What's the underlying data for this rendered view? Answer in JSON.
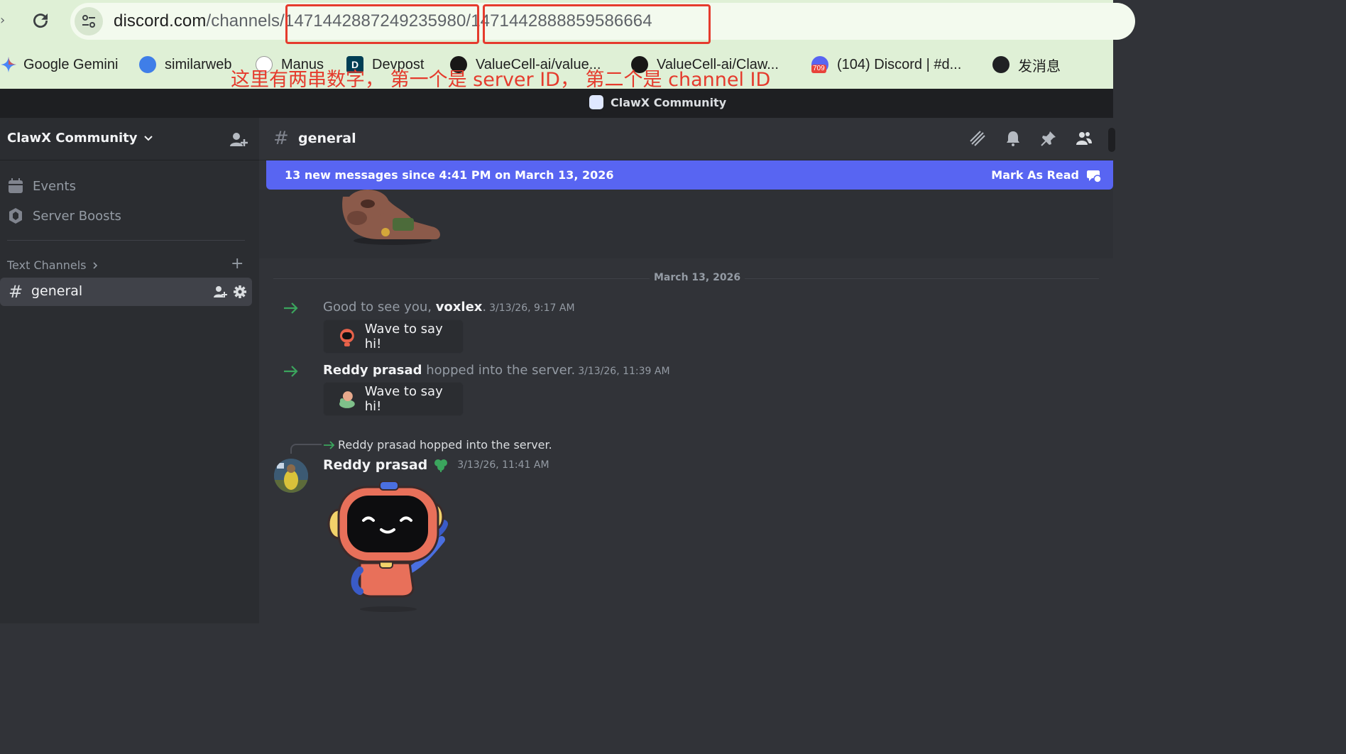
{
  "browser": {
    "url_host": "discord.com",
    "url_path": "/channels/",
    "server_id": "1471442887249235980",
    "url_sep": "/",
    "channel_id": "1471442888859586664",
    "bookmarks": [
      {
        "label": "Google Gemini",
        "icon": "gemini-icon"
      },
      {
        "label": "similarweb",
        "icon": "similarweb-icon"
      },
      {
        "label": "Manus",
        "icon": "manus-icon"
      },
      {
        "label": "Devpost",
        "icon": "devpost-icon"
      },
      {
        "label": "ValueCell-ai/value...",
        "icon": "github-icon"
      },
      {
        "label": "ValueCell-ai/Claw...",
        "icon": "github-icon"
      },
      {
        "label": "(104) Discord | #d...",
        "icon": "discord-icon",
        "badge": "709"
      },
      {
        "label": "发消息",
        "icon": "globe-icon"
      }
    ],
    "annotation": "这里有两串数字， 第一个是 server ID， 第二个是 channel ID"
  },
  "titlebar": {
    "title": "ClawX Community"
  },
  "sidebar": {
    "server_name": "ClawX Community",
    "items": [
      {
        "label": "Events",
        "icon": "calendar-icon"
      },
      {
        "label": "Server Boosts",
        "icon": "boost-icon"
      }
    ],
    "category": "Text Channels",
    "channel": "general"
  },
  "main": {
    "channel_title": "general",
    "new_messages": "13 new messages since 4:41 PM on March 13, 2026",
    "mark_as_read": "Mark As Read",
    "date_divider": "March 13, 2026",
    "messages": [
      {
        "prefix": "Good to see you, ",
        "user": "voxlex",
        "suffix": ".",
        "timestamp": "3/13/26, 9:17 AM",
        "button": "Wave to say hi!"
      },
      {
        "prefix": "",
        "user": "Reddy prasad",
        "suffix": " hopped into the server.",
        "timestamp": "3/13/26, 11:39 AM",
        "button": "Wave to say hi!"
      }
    ],
    "reply_preview": "Reddy prasad hopped into the server.",
    "post": {
      "author": "Reddy prasad",
      "timestamp": "3/13/26, 11:41 AM"
    }
  },
  "colors": {
    "accent": "#5865f2",
    "annotation": "#e53b2d",
    "join_arrow": "#3ba55d"
  }
}
